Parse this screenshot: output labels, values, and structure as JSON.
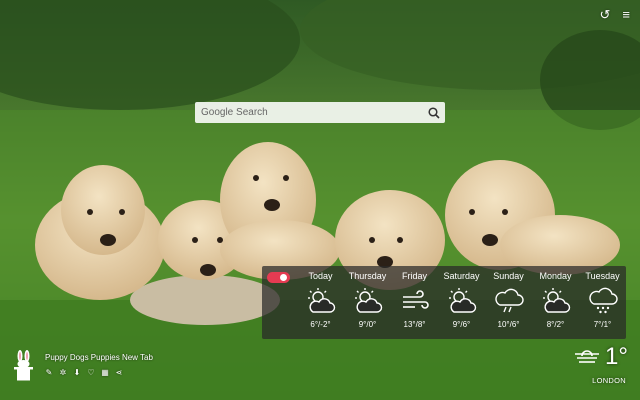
{
  "search": {
    "placeholder": "Google Search"
  },
  "top_icons": {
    "history": "↺",
    "menu": "≡"
  },
  "weather": {
    "days": [
      {
        "name": "Today",
        "icon": "partly-sunny-icon",
        "temp": "6°/-2°"
      },
      {
        "name": "Thursday",
        "icon": "partly-sunny-icon",
        "temp": "9°/0°"
      },
      {
        "name": "Friday",
        "icon": "wind-icon",
        "temp": "13°/8°"
      },
      {
        "name": "Saturday",
        "icon": "partly-sunny-icon",
        "temp": "9°/6°"
      },
      {
        "name": "Sunday",
        "icon": "rain-icon",
        "temp": "10°/6°"
      },
      {
        "name": "Monday",
        "icon": "partly-sunny-icon",
        "temp": "8°/2°"
      },
      {
        "name": "Tuesday",
        "icon": "snow-icon",
        "temp": "7°/1°"
      }
    ],
    "current": {
      "temp": "1°",
      "icon": "fog-icon",
      "city": "LONDON"
    }
  },
  "app": {
    "title": "Puppy Dogs Puppies New Tab",
    "tools": [
      "✎",
      "✲",
      "⬇",
      "♡",
      "▦",
      "⋖"
    ]
  },
  "colors": {
    "toggle": "#e53b52",
    "panel": "#282828"
  }
}
